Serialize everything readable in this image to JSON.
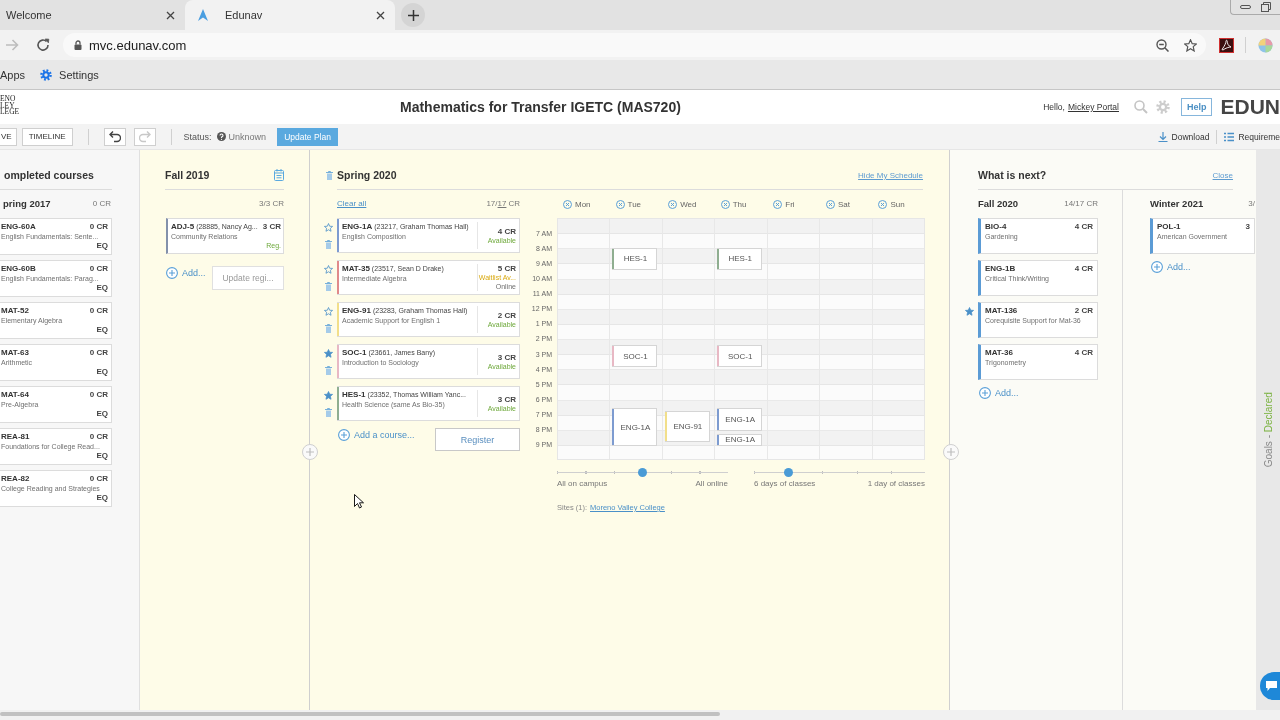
{
  "browser": {
    "tabs": [
      {
        "title": "Welcome",
        "selected": false
      },
      {
        "title": "Edunav",
        "selected": true
      }
    ],
    "nav": [
      {
        "kind": "forward",
        "disabled": true
      },
      {
        "kind": "reload",
        "disabled": false
      }
    ],
    "url": "mvc.edunav.com",
    "bookmarks": [
      {
        "kind": "link",
        "label": "Apps"
      },
      {
        "kind": "settings",
        "label": "Settings"
      }
    ]
  },
  "header": {
    "logo_lines": [
      "ENO",
      "LEY",
      "LEGE"
    ],
    "title": "Mathematics for Transfer IGETC (MAS720)",
    "greeting": "Hello,",
    "user": "Mickey Portal",
    "help": "Help",
    "brand": "EDUN"
  },
  "toolbar": {
    "views": [
      "VE",
      "TIMELINE"
    ],
    "history": [
      {
        "kind": "undo",
        "disabled": false
      },
      {
        "kind": "redo",
        "disabled": true
      }
    ],
    "status_label": "Status:",
    "status": "Unknown",
    "update": "Update Plan",
    "actions": [
      {
        "kind": "download",
        "label": "Download"
      },
      {
        "kind": "list",
        "label": "Requireme"
      }
    ]
  },
  "completed": {
    "title": "ompleted courses",
    "term": "pring 2017",
    "credits": "0 CR",
    "courses": [
      {
        "code": "ENG-60A",
        "credits": "0 CR",
        "name": "English Fundamentals: Sente...",
        "tag": "EQ"
      },
      {
        "code": "ENG-60B",
        "credits": "0 CR",
        "name": "English Fundamentals: Parag...",
        "tag": "EQ"
      },
      {
        "code": "MAT-52",
        "credits": "0 CR",
        "name": "Elementary Algebra",
        "tag": "EQ"
      },
      {
        "code": "MAT-63",
        "credits": "0 CR",
        "name": "Arithmetic",
        "tag": "EQ"
      },
      {
        "code": "MAT-64",
        "credits": "0 CR",
        "name": "Pre-Algebra",
        "tag": "EQ"
      },
      {
        "code": "REA-81",
        "credits": "0 CR",
        "name": "Foundations for College Read...",
        "tag": "EQ"
      },
      {
        "code": "REA-82",
        "credits": "0 CR",
        "name": "College Reading and Strategies",
        "tag": "EQ"
      }
    ]
  },
  "registered_term": {
    "title": "Fall 2019",
    "credits": "3/3 CR",
    "courses": [
      {
        "code": "ADJ-5",
        "detail": "(28885, Nancy Ag...",
        "credits": "3 CR",
        "name": "Community Relations",
        "status": "Reg."
      }
    ],
    "add": "Add...",
    "update_button": {
      "label": "Update regi...",
      "disabled": true
    }
  },
  "schedule_term": {
    "title": "Spring 2020",
    "hide_link": "Hide My Schedule",
    "clear_link": "Clear all",
    "credits_used": "17/",
    "credits_planned": "17",
    "credits_unit": "CR",
    "courses": [
      {
        "code": "ENG-1A",
        "detail": "(23217, Graham Thomas Hall)",
        "name": "English Composition",
        "credits": "4 CR",
        "status": {
          "kind": "available",
          "text": "Available"
        },
        "starred": false,
        "color": "#7d9bd0"
      },
      {
        "code": "MAT-35",
        "detail": "(23517, Sean D Drake)",
        "name": "Intermediate Algebra",
        "credits": "5 CR",
        "status": {
          "kind": "waitlist",
          "text": "Waitlist Av..."
        },
        "mode": "Online",
        "starred": false,
        "color": "#e08a8a"
      },
      {
        "code": "ENG-91",
        "detail": "(23283, Graham Thomas Hall)",
        "name": "Academic Support for English 1",
        "credits": "2 CR",
        "status": {
          "kind": "available",
          "text": "Available"
        },
        "starred": false,
        "color": "#f2df8a"
      },
      {
        "code": "SOC-1",
        "detail": "(23661, James Bany)",
        "name": "Introduction to Sociology",
        "credits": "3 CR",
        "status": {
          "kind": "available",
          "text": "Available"
        },
        "starred": true,
        "color": "#e8b8c4"
      },
      {
        "code": "HES-1",
        "detail": "(23352, Thomas William Yanc...",
        "name": "Health Science (same As Bio-35)",
        "credits": "3 CR",
        "status": {
          "kind": "available",
          "text": "Available"
        },
        "starred": true,
        "color": "#8fae90"
      }
    ],
    "add": "Add a course...",
    "register": "Register"
  },
  "schedule": {
    "days": [
      {
        "label": "Mon"
      },
      {
        "label": "Tue",
        "events": [
          {
            "label": "HES-1",
            "color": "#8fae90"
          },
          {
            "label": "SOC-1",
            "color": "#e8b8c4"
          },
          {
            "label": "ENG-1A",
            "color": "#7d9bd0"
          }
        ]
      },
      {
        "label": "Wed",
        "events": [
          {
            "label": "ENG-91",
            "color": "#f2df8a"
          }
        ]
      },
      {
        "label": "Thu",
        "events": [
          {
            "label": "HES-1",
            "color": "#8fae90"
          },
          {
            "label": "SOC-1",
            "color": "#e8b8c4"
          },
          {
            "label": "ENG-1A",
            "color": "#7d9bd0"
          },
          {
            "label": "ENG-1A",
            "color": "#7d9bd0"
          }
        ]
      },
      {
        "label": "Fri"
      },
      {
        "label": "Sat"
      },
      {
        "label": "Sun"
      }
    ],
    "hours": [
      "7 AM",
      "8 AM",
      "9 AM",
      "10 AM",
      "11 AM",
      "12 PM",
      "1 PM",
      "2 PM",
      "3 PM",
      "4 PM",
      "5 PM",
      "6 PM",
      "7 PM",
      "8 PM",
      "9 PM"
    ],
    "sliders": [
      {
        "level": 0.5,
        "left": "All on campus",
        "right": "All online"
      },
      {
        "level": 0.2,
        "left": "6 days of classes",
        "right": "1 day of classes"
      }
    ],
    "sites_label": "Sites (1):",
    "site": "Moreno Valley College"
  },
  "next": {
    "title": "What is next?",
    "close": "Close",
    "terms": [
      {
        "title": "Fall 2020",
        "credits": "14/17 CR",
        "courses": [
          {
            "code": "BIO-4",
            "credits": "4 CR",
            "name": "Gardening",
            "starred": false
          },
          {
            "code": "ENG-1B",
            "credits": "4 CR",
            "name": "Critical Think/Writing",
            "starred": false
          },
          {
            "code": "MAT-136",
            "credits": "2 CR",
            "name": "Corequisite Support for Mat-36",
            "starred": true
          },
          {
            "code": "MAT-36",
            "credits": "4 CR",
            "name": "Trigonometry",
            "starred": false
          }
        ],
        "add": "Add..."
      },
      {
        "title": "Winter 2021",
        "credits": "3/",
        "courses": [
          {
            "code": "POL-1",
            "credits": "3",
            "name": "American Government",
            "starred": false
          }
        ],
        "add": "Add..."
      }
    ]
  },
  "goals": {
    "label": "Goals -",
    "status": "Declared"
  }
}
